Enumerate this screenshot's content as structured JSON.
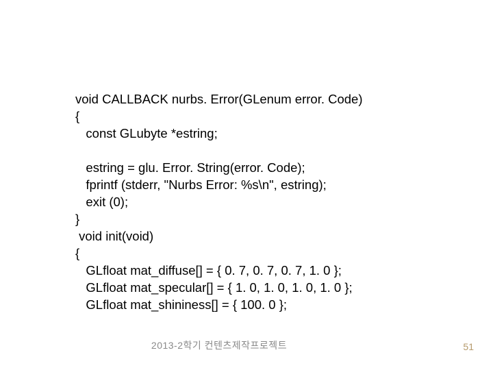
{
  "code": {
    "l1": "void CALLBACK nurbs. Error(GLenum error. Code)",
    "l2": "{",
    "l3": "   const GLubyte *estring;",
    "l4": "",
    "l5": "   estring = glu. Error. String(error. Code);",
    "l6": "   fprintf (stderr, \"Nurbs Error: %s\\n\", estring);",
    "l7": "   exit (0);",
    "l8": "}",
    "l9": " void init(void)",
    "l10": "{",
    "l11": "   GLfloat mat_diffuse[] = { 0. 7, 0. 7, 0. 7, 1. 0 };",
    "l12": "   GLfloat mat_specular[] = { 1. 0, 1. 0, 1. 0, 1. 0 };",
    "l13": "   GLfloat mat_shininess[] = { 100. 0 };"
  },
  "footer": {
    "center": "2013-2학기   컨텐츠제작프로젝트",
    "page": "51"
  }
}
